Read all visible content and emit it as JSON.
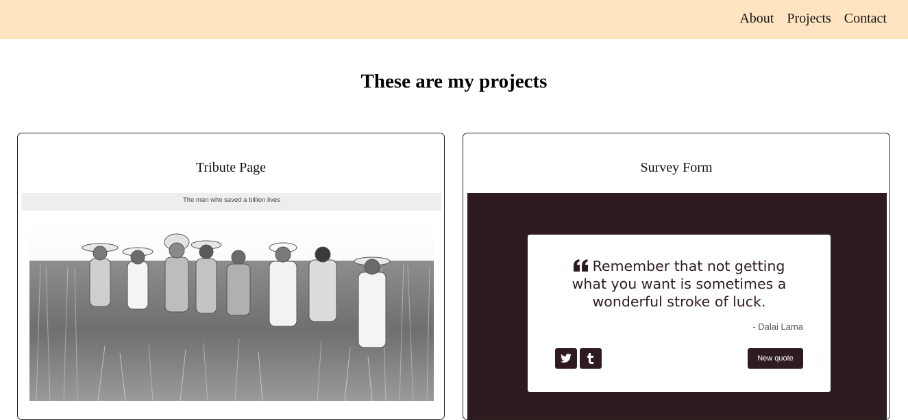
{
  "nav": {
    "links": [
      {
        "label": "About"
      },
      {
        "label": "Projects"
      },
      {
        "label": "Contact"
      }
    ]
  },
  "main": {
    "title": "These are my projects"
  },
  "projects": [
    {
      "title": "Tribute Page",
      "preview": {
        "header_text": "The man who saved a billion lives"
      }
    },
    {
      "title": "Survey Form",
      "preview": {
        "quote": "Remember that not getting what you want is sometimes a wonderful stroke of luck.",
        "author": "- Dalai Lama",
        "new_quote_label": "New quote",
        "icons": [
          "quote-left-icon",
          "twitter-icon",
          "tumblr-icon"
        ]
      }
    }
  ],
  "colors": {
    "navbar_bg": "#ffe4c2",
    "quote_bg": "#2e1b1f",
    "tribute_bar_bg": "#eeeeee"
  }
}
